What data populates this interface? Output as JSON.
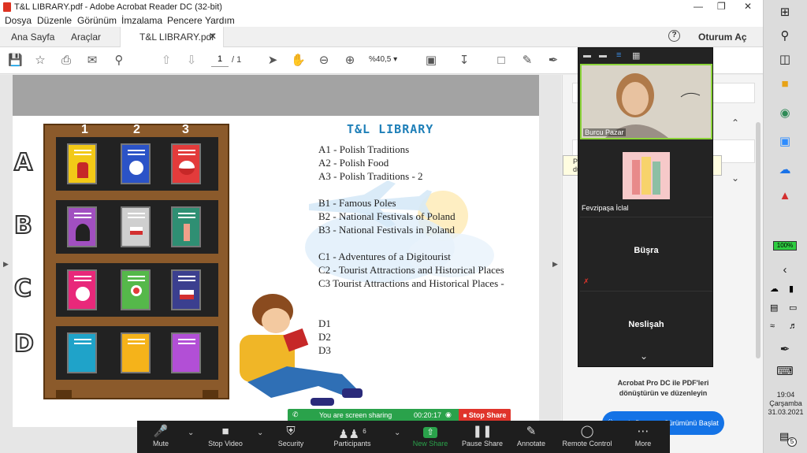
{
  "window": {
    "title": "T&L LIBRARY.pdf - Adobe Acrobat Reader DC (32-bit)"
  },
  "menu": [
    "Dosya",
    "Düzenle",
    "Görünüm",
    "İmzalama",
    "Pencere",
    "Yardım"
  ],
  "tabs": {
    "home": "Ana Sayfa",
    "tools": "Araçlar",
    "document": "T&L LIBRARY.pdf",
    "signin": "Oturum Aç"
  },
  "toolbar": {
    "page_current": "1",
    "page_total": "/ 1",
    "zoom": "%40,5"
  },
  "document": {
    "heading": "T&L LIBRARY",
    "shelf_columns": [
      "1",
      "2",
      "3"
    ],
    "shelf_rows": [
      "A",
      "B",
      "C",
      "D"
    ],
    "items": [
      "A1 - Polish Traditions",
      "A2 - Polish Food",
      "A3 - Polish Traditions - 2",
      "B1 - Famous Poles",
      "B2 - National Festivals of Poland",
      "B3 - National Festivals in Poland",
      "C1 - Adventures of a Digitourist",
      "C2 - Tourist Attractions and Historical Places",
      "C3 Tourist Attractions and Historical Places -",
      "D1",
      "D2",
      "D3"
    ]
  },
  "right_pane": {
    "promo_line1": "Acrobat Pro DC ile PDF'leri",
    "promo_line2": "dönüştürün ve düzenleyin",
    "button": "Ücretsiz Deneme Sürümünü Başlat",
    "tooltip_a": "P",
    "tooltip_b": "dü"
  },
  "zoom": {
    "participants_tiles": [
      {
        "name": "Burcu Pazar"
      },
      {
        "name": "Fevzipaşa İclal"
      },
      {
        "name": "Büşra"
      },
      {
        "name": "Neslişah"
      }
    ],
    "sharing_banner": "You are screen sharing",
    "share_timer": "00:20:17",
    "stop_share": "Stop Share",
    "participant_count": "6",
    "controls": [
      {
        "label": "Mute",
        "icon": "microphone-icon"
      },
      {
        "label": "Stop Video",
        "icon": "video-camera-icon"
      },
      {
        "label": "Security",
        "icon": "shield-icon"
      },
      {
        "label": "Participants",
        "icon": "people-icon"
      },
      {
        "label": "New Share",
        "icon": "share-arrow-icon"
      },
      {
        "label": "Pause Share",
        "icon": "pause-icon"
      },
      {
        "label": "Annotate",
        "icon": "pencil-icon"
      },
      {
        "label": "Remote Control",
        "icon": "mouse-icon"
      },
      {
        "label": "More",
        "icon": "ellipsis-icon"
      }
    ]
  },
  "taskbar": {
    "battery": "100%",
    "time": "19:04",
    "day": "Çarşamba",
    "date": "31.03.2021",
    "notifications": "5"
  },
  "colors": {
    "zoom_green": "#2aa24b",
    "zoom_red": "#e0342b",
    "acrobat_red": "#d32f2f",
    "acrobat_blue": "#1473e6"
  }
}
